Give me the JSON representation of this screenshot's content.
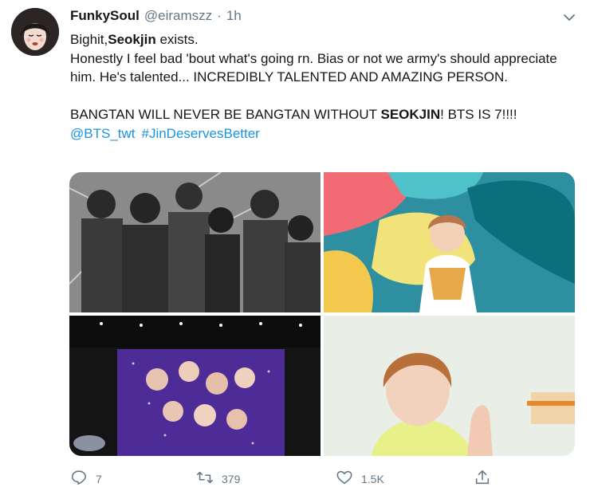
{
  "tweet": {
    "author": {
      "display_name": "FunkySoul",
      "handle": "@eiramszz",
      "separator": "·",
      "time": "1h",
      "avatar_icon": "avatar-illustration"
    },
    "menu_icon": "chevron-down-icon",
    "body": {
      "line1_prefix": "Bighit,",
      "line1_bold": "Seokjin",
      "line1_suffix": " exists.",
      "line2": "Honestly I feel bad 'bout what's going rn. Bias or not we army's should appreciate him. He's talented... INCREDIBLY TALENTED AND AMAZING PERSON.",
      "line3_prefix": "BANGTAN WILL NEVER BE BANGTAN WITHOUT ",
      "line3_bold": "SEOKJIN",
      "line3_suffix": "! BTS IS 7!!!!",
      "mention": "@BTS_twt",
      "hashtag": "#JinDeservesBetter"
    },
    "media": [
      {
        "name": "group-photo-black-white"
      },
      {
        "name": "photo-colorful-wall"
      },
      {
        "name": "concert-screen-photo"
      },
      {
        "name": "video-still-closeup"
      }
    ],
    "actions": {
      "reply_count": "7",
      "retweet_count": "379",
      "like_count": "1.5K"
    },
    "colors": {
      "text": "#14171a",
      "secondary": "#657786",
      "link": "#1b95e0"
    }
  }
}
